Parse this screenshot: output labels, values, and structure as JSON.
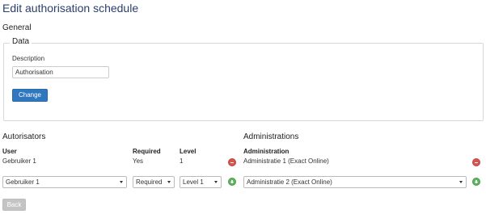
{
  "page": {
    "title": "Edit authorisation schedule"
  },
  "general": {
    "section_title": "General",
    "legend": "Data",
    "description_label": "Description",
    "description_value": "Authorisation",
    "change_button": "Change"
  },
  "autorisators": {
    "heading": "Autorisators",
    "columns": {
      "user": "User",
      "required": "Required",
      "level": "Level"
    },
    "row": {
      "user": "Gebruiker 1",
      "required": "Yes",
      "level": "1"
    },
    "new_row": {
      "user": "Gebruiker 1",
      "required": "Required",
      "level": "Level 1"
    }
  },
  "administrations": {
    "heading": "Administrations",
    "column": "Administration",
    "row": "Administratie 1 (Exact Online)",
    "new_row": "Administratie 2 (Exact Online)"
  },
  "footer": {
    "back_button": "Back"
  },
  "colors": {
    "primary": "#2f78c0",
    "danger": "#d9534f",
    "success": "#5cb85c",
    "title": "#2a3f6b",
    "disabled": "#c4c4c4"
  },
  "icons": {
    "remove": "minus-circle-icon",
    "add": "plus-circle-icon",
    "dropdown": "chevron-down-icon"
  }
}
